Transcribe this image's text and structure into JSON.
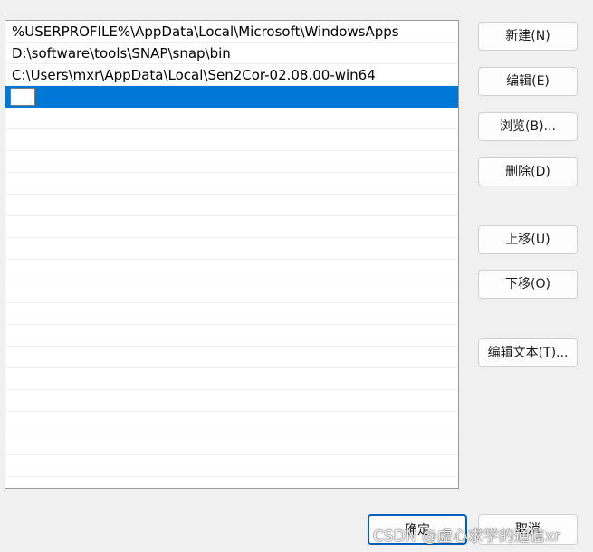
{
  "path_list": {
    "entries": [
      "%USERPROFILE%\\AppData\\Local\\Microsoft\\WindowsApps",
      "D:\\software\\tools\\SNAP\\snap\\bin",
      "C:\\Users\\mxr\\AppData\\Local\\Sen2Cor-02.08.00-win64"
    ],
    "editing_value": ""
  },
  "buttons": {
    "new": "新建(N)",
    "edit": "编辑(E)",
    "browse": "浏览(B)...",
    "delete": "删除(D)",
    "move_up": "上移(U)",
    "move_down": "下移(O)",
    "edit_text": "编辑文本(T)..."
  },
  "footer": {
    "ok": "确定",
    "cancel": "取消"
  },
  "watermark": "CSDN @虚心求学的通信xr",
  "colors": {
    "selection": "#0078d7",
    "background": "#f0f0f0",
    "default_button_border": "#005fb8"
  }
}
